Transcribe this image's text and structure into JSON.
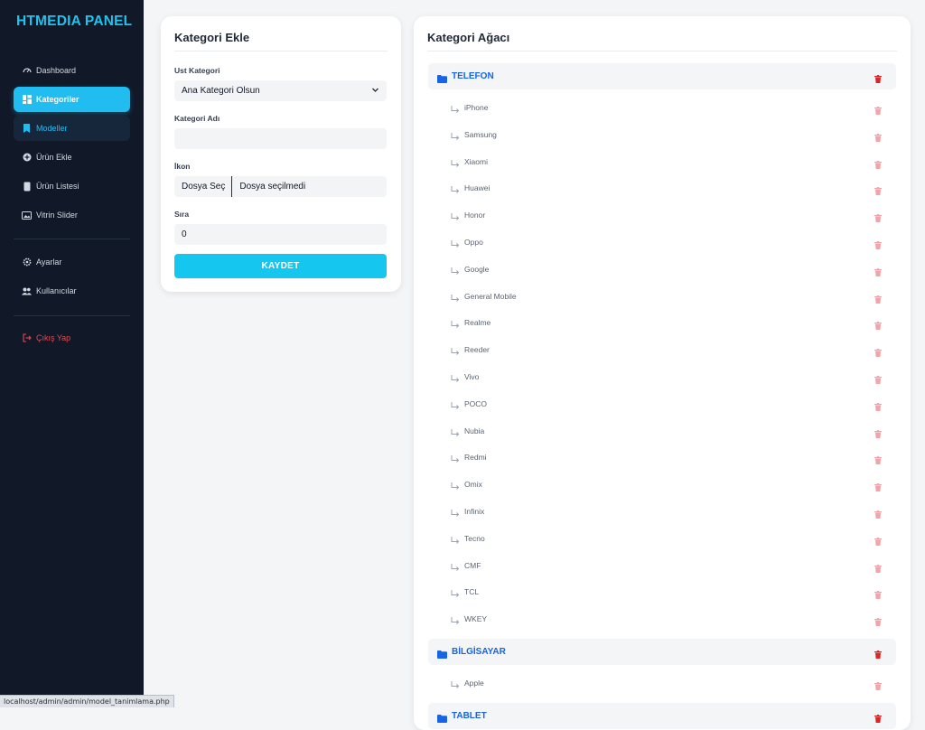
{
  "brand": "HTMEDIA PANEL",
  "status_url": "localhost/admin/admin/model_tanimlama.php",
  "nav": {
    "dashboard": "Dashboard",
    "kategoriler": "Kategoriler",
    "modeller": "Modeller",
    "urun_ekle": "Ürün Ekle",
    "urun_listesi": "Ürün Listesi",
    "vitrin_slider": "Vitrin Slider",
    "ayarlar": "Ayarlar",
    "kullanicilar": "Kullanıcılar",
    "cikis": "Çıkış Yap"
  },
  "form": {
    "title": "Kategori Ekle",
    "parent_label": "Ust Kategori",
    "parent_value": "Ana Kategori Olsun",
    "name_label": "Kategori Adı",
    "name_value": "",
    "icon_label": "İkon",
    "file_button": "Dosya Seç",
    "file_status": "Dosya seçilmedi",
    "order_label": "Sıra",
    "order_value": "0",
    "save_label": "KAYDET"
  },
  "tree": {
    "title": "Kategori Ağacı",
    "groups": [
      {
        "name": "TELEFON",
        "children": [
          "iPhone",
          "Samsung",
          "Xiaomi",
          "Huawei",
          "Honor",
          "Oppo",
          "Google",
          "General Mobile",
          "Realme",
          "Reeder",
          "Vivo",
          "POCO",
          "Nubia",
          "Redmi",
          "Omix",
          "Infinix",
          "Tecno",
          "CMF",
          "TCL",
          "WKEY"
        ]
      },
      {
        "name": "BİLGİSAYAR",
        "children": [
          "Apple"
        ]
      },
      {
        "name": "TABLET",
        "children": []
      }
    ]
  },
  "colors": {
    "accent": "#22bdf0",
    "sidebar_bg": "#111827",
    "parent_text": "#1565e6",
    "trash_parent": "#dc2626",
    "trash_child": "#f4a3a8"
  }
}
